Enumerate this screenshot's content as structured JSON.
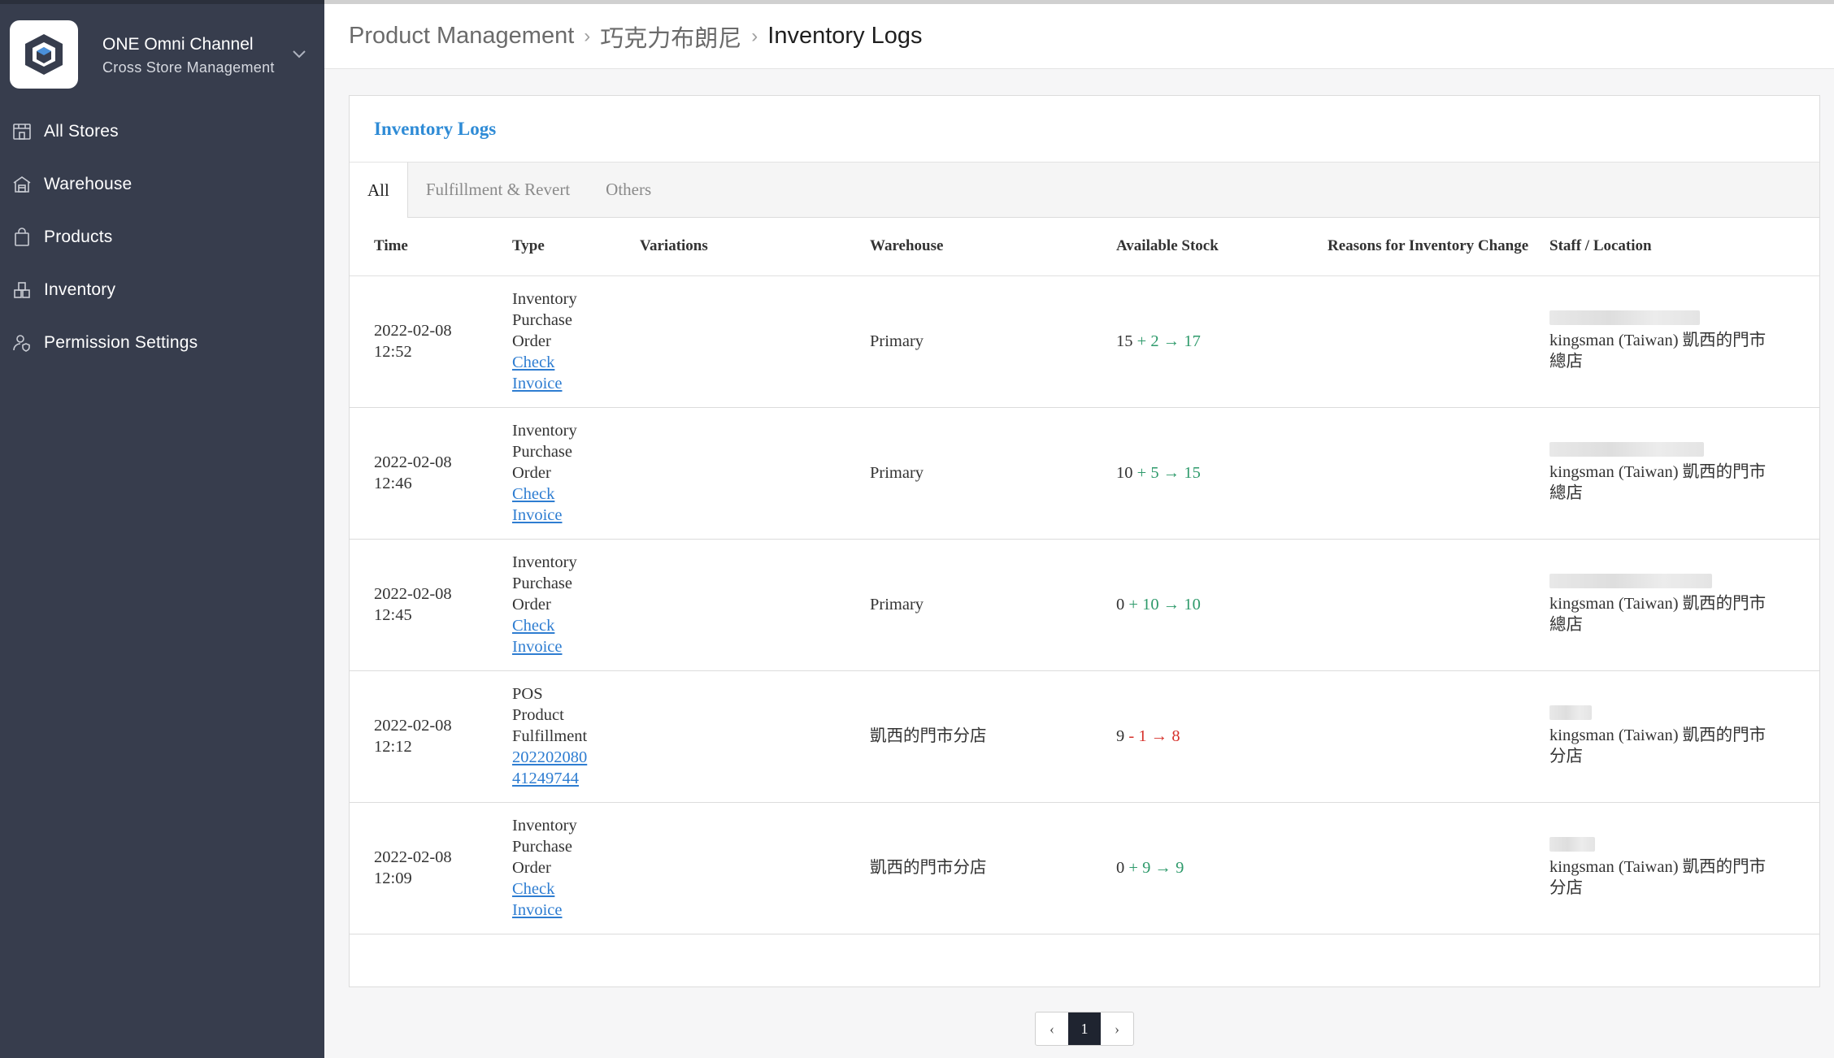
{
  "sidebar": {
    "brand_title": "ONE Omni Channel",
    "brand_subtitle": "Cross Store Management",
    "items": [
      {
        "label": "All Stores",
        "icon": "store-icon"
      },
      {
        "label": "Warehouse",
        "icon": "warehouse-icon"
      },
      {
        "label": "Products",
        "icon": "shopping-bag-icon"
      },
      {
        "label": "Inventory",
        "icon": "boxes-icon"
      },
      {
        "label": "Permission Settings",
        "icon": "user-shield-icon"
      }
    ]
  },
  "breadcrumb": {
    "items": [
      "Product Management",
      "巧克力布朗尼"
    ],
    "current": "Inventory Logs"
  },
  "card": {
    "title": "Inventory Logs",
    "tabs": [
      "All",
      "Fulfillment & Revert",
      "Others"
    ]
  },
  "table": {
    "headers": {
      "time": "Time",
      "type": "Type",
      "variations": "Variations",
      "warehouse": "Warehouse",
      "stock": "Available Stock",
      "reason": "Reasons for Inventory Change",
      "staff": "Staff / Location"
    },
    "rows": [
      {
        "date": "2022-02-08",
        "clock": "12:52",
        "type": [
          "Inventory",
          "Purchase",
          "Order"
        ],
        "link": [
          "Check",
          "Invoice"
        ],
        "variations": "",
        "warehouse": "Primary",
        "from": "15",
        "op": "+",
        "delta": "2",
        "to": "17",
        "dir": "up",
        "reason": "",
        "location": "kingsman (Taiwan) 凱西的門市總店"
      },
      {
        "date": "2022-02-08",
        "clock": "12:46",
        "type": [
          "Inventory",
          "Purchase",
          "Order"
        ],
        "link": [
          "Check",
          "Invoice"
        ],
        "variations": "",
        "warehouse": "Primary",
        "from": "10",
        "op": "+",
        "delta": "5",
        "to": "15",
        "dir": "up",
        "reason": "",
        "location": "kingsman (Taiwan) 凱西的門市總店"
      },
      {
        "date": "2022-02-08",
        "clock": "12:45",
        "type": [
          "Inventory",
          "Purchase",
          "Order"
        ],
        "link": [
          "Check",
          "Invoice"
        ],
        "variations": "",
        "warehouse": "Primary",
        "from": "0",
        "op": "+",
        "delta": "10",
        "to": "10",
        "dir": "up",
        "reason": "",
        "location": "kingsman (Taiwan) 凱西的門市總店"
      },
      {
        "date": "2022-02-08",
        "clock": "12:12",
        "type": [
          "POS",
          "Product",
          "Fulfillment"
        ],
        "link": [
          "202202080",
          "41249744"
        ],
        "variations": "",
        "warehouse": "凱西的門市分店",
        "from": "9",
        "op": "-",
        "delta": "1",
        "to": "8",
        "dir": "down",
        "reason": "",
        "location": "kingsman (Taiwan) 凱西的門市分店"
      },
      {
        "date": "2022-02-08",
        "clock": "12:09",
        "type": [
          "Inventory",
          "Purchase",
          "Order"
        ],
        "link": [
          "Check",
          "Invoice"
        ],
        "variations": "",
        "warehouse": "凱西的門市分店",
        "from": "0",
        "op": "+",
        "delta": "9",
        "to": "9",
        "dir": "up",
        "reason": "",
        "location": "kingsman (Taiwan) 凱西的門市分店"
      }
    ]
  },
  "pagination": {
    "prev": "‹",
    "current": "1",
    "next": "›"
  },
  "colors": {
    "sidebar_bg": "#373d4d",
    "link": "#2e7dd1",
    "title_blue": "#2e8bd6",
    "increase": "#2e9a6b",
    "decrease": "#d6312b"
  }
}
